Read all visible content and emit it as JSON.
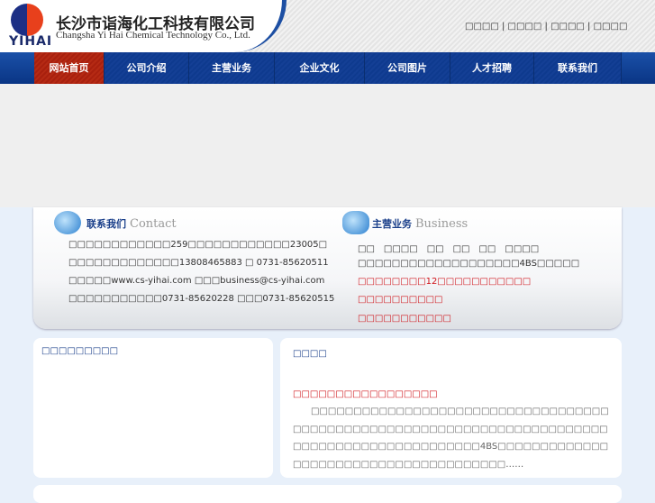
{
  "header": {
    "logo_word": "YIHAI",
    "company_cn": "长沙市诣海化工科技有限公司",
    "company_en": "Changsha Yi Hai Chemical Technology Co., Ltd.",
    "top_links": [
      "□□□□",
      "□□□□",
      "□□□□",
      "□□□□"
    ]
  },
  "nav": [
    "网站首页",
    "公司介绍",
    "主营业务",
    "企业文化",
    "公司图片",
    "人才招聘",
    "联系我们"
  ],
  "contact": {
    "title_cn": "联系我们",
    "title_en": "Contact",
    "lines": [
      "□□□□□□□□□□□□259□□□□□□□□□□□□23005□",
      "□□□□□□□□□□□□□13808465883 □ 0731-85620511",
      "□□□□□www.cs-yihai.com □□□business@cs-yihai.com",
      "□□□□□□□□□□□0731-85620228 □□□0731-85620515"
    ]
  },
  "business": {
    "title_cn": "主营业务",
    "title_en": "Business",
    "lines": [
      "□□　□□□□　□□　□□　□□　□□□□",
      "□□□□□□□□□□□□□□□□□□□4BS□□□□□"
    ],
    "red_lines": [
      "□□□□□□□□12□□□□□□□□□□□",
      "□□□□□□□□□□",
      "□□□□□□□□□□□"
    ]
  },
  "left_card": {
    "title": "□□□□□□□□□"
  },
  "right_card": {
    "title": "□□□□",
    "headline": "□□□□□□□□□□□□□□□□□",
    "paragraph": "□□□□□□□□□□□□□□□□□□□□□□□□□□□□□□□□□□□□□□□□□□□□□□□□□□□□□□□□□□□□□□□□□□□□□□□□□□□□□□□□□□□□□□□□□□□□□□4BS□□□□□□□□□□□□□□□□□□□□□□□□□□□□□□□□□□□□□□……"
  }
}
